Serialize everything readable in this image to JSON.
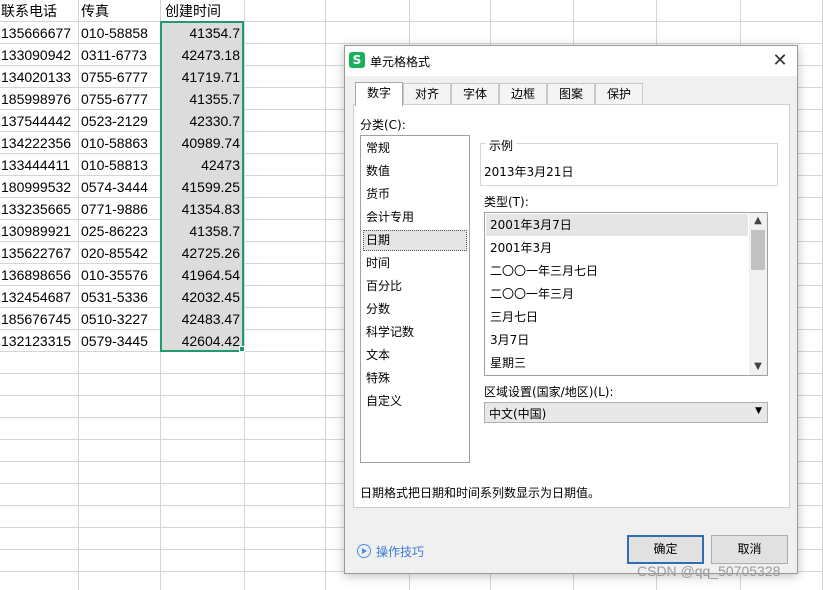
{
  "spreadsheet": {
    "headers": [
      "联系电话",
      "传真",
      "创建时间"
    ],
    "rows": [
      [
        "135666677",
        "010-58858",
        "41354.7"
      ],
      [
        "133090942",
        "0311-6773",
        "42473.18"
      ],
      [
        "134020133",
        "0755-6777",
        "41719.71"
      ],
      [
        "185998976",
        "0755-6777",
        "41355.7"
      ],
      [
        "137544442",
        "0523-2129",
        "42330.7"
      ],
      [
        "134222356",
        "010-58863",
        "40989.74"
      ],
      [
        "133444411",
        "010-58813",
        "42473"
      ],
      [
        "180999532",
        "0574-3444",
        "41599.25"
      ],
      [
        "133235665",
        "0771-9886",
        "41354.83"
      ],
      [
        "130989921",
        "025-86223",
        "41358.7"
      ],
      [
        "135622767",
        "020-85542",
        "42725.26"
      ],
      [
        "136898656",
        "010-35576",
        "41964.54"
      ],
      [
        "132454687",
        "0531-5336",
        "42032.45"
      ],
      [
        "185676745",
        "0510-3227",
        "42483.47"
      ],
      [
        "132123315",
        "0579-3445",
        "42604.42"
      ]
    ]
  },
  "dialog": {
    "app_icon": "S",
    "title": "单元格格式",
    "close_icon": "close-icon",
    "tabs": [
      "数字",
      "对齐",
      "字体",
      "边框",
      "图案",
      "保护"
    ],
    "active_tab": "数字",
    "category_label": "分类(C):",
    "categories": [
      "常规",
      "数值",
      "货币",
      "会计专用",
      "日期",
      "时间",
      "百分比",
      "分数",
      "科学记数",
      "文本",
      "特殊",
      "自定义"
    ],
    "selected_category": "日期",
    "sample_label": "示例",
    "sample_value": "2013年3月21日",
    "type_label": "类型(T):",
    "types": [
      "2001年3月7日",
      "2001年3月",
      "二〇〇一年三月七日",
      "二〇〇一年三月",
      "三月七日",
      "3月7日",
      "星期三"
    ],
    "selected_type": "2001年3月7日",
    "locale_label": "区域设置(国家/地区)(L):",
    "locale_value": "中文(中国)",
    "description": "日期格式把日期和时间系列数显示为日期值。",
    "tips_link": "操作技巧",
    "ok_label": "确定",
    "cancel_label": "取消"
  },
  "watermark": "CSDN @qq_50705328",
  "colors": {
    "selection_border": "#1e9c6b",
    "app_icon": "#1bb05e",
    "link": "#3a7bd5",
    "ok_border": "#2f6db5"
  }
}
